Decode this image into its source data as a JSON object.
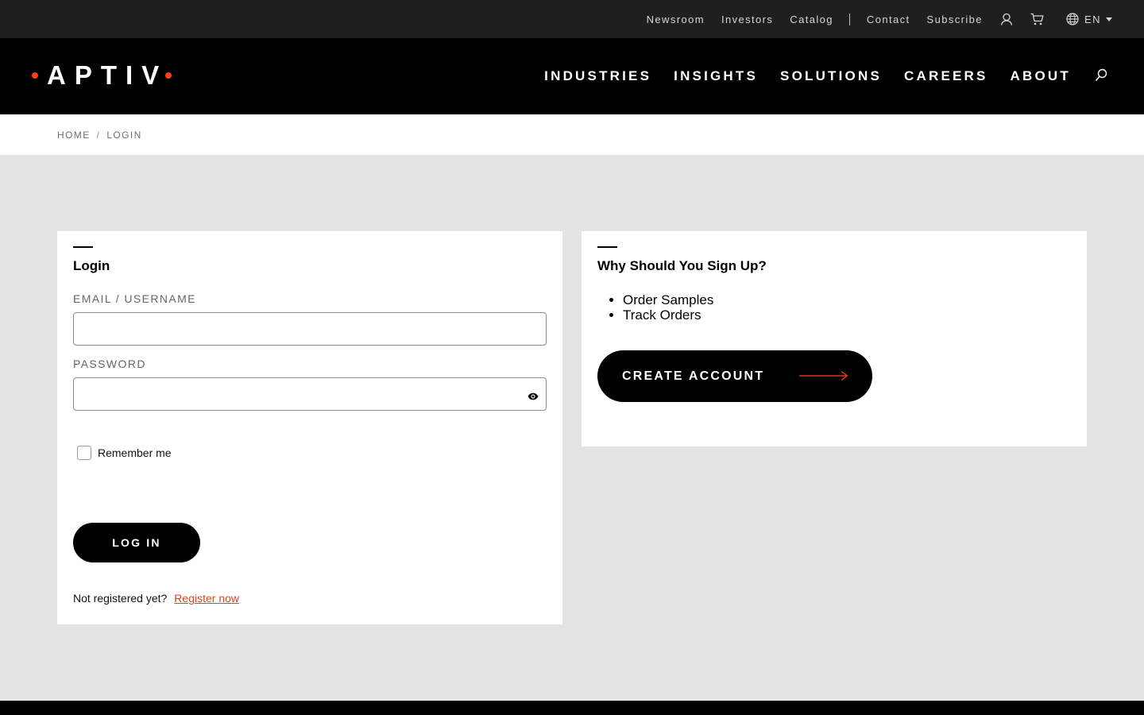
{
  "utility_bar": {
    "links": [
      "Newsroom",
      "Investors",
      "Catalog"
    ],
    "links_right": [
      "Contact",
      "Subscribe"
    ],
    "account_icon": "user-icon",
    "cart_icon": "cart-icon",
    "language": {
      "icon": "globe-icon",
      "code": "EN"
    }
  },
  "header": {
    "logo_text": "APTIV",
    "logo_accent_color": "#f84018",
    "nav": [
      "INDUSTRIES",
      "INSIGHTS",
      "SOLUTIONS",
      "CAREERS",
      "ABOUT"
    ],
    "search_icon": "search-icon"
  },
  "breadcrumb": {
    "items": [
      "HOME",
      "LOGIN"
    ],
    "separator": "/"
  },
  "login": {
    "title": "Login",
    "email_label": "EMAIL / USERNAME",
    "email_value": "",
    "password_label": "PASSWORD",
    "password_value": "",
    "show_password_icon": "eye-icon",
    "remember_label": "Remember me",
    "remember_checked": false,
    "submit_label": "LOG IN",
    "register_prompt": "Not registered yet?",
    "register_link": "Register now",
    "link_color": "#e5401f"
  },
  "signup": {
    "title": "Why Should You Sign Up?",
    "benefits": [
      "Order Samples",
      "Track Orders"
    ],
    "cta_label": "CREATE ACCOUNT",
    "cta_icon": "arrow-right-icon"
  }
}
